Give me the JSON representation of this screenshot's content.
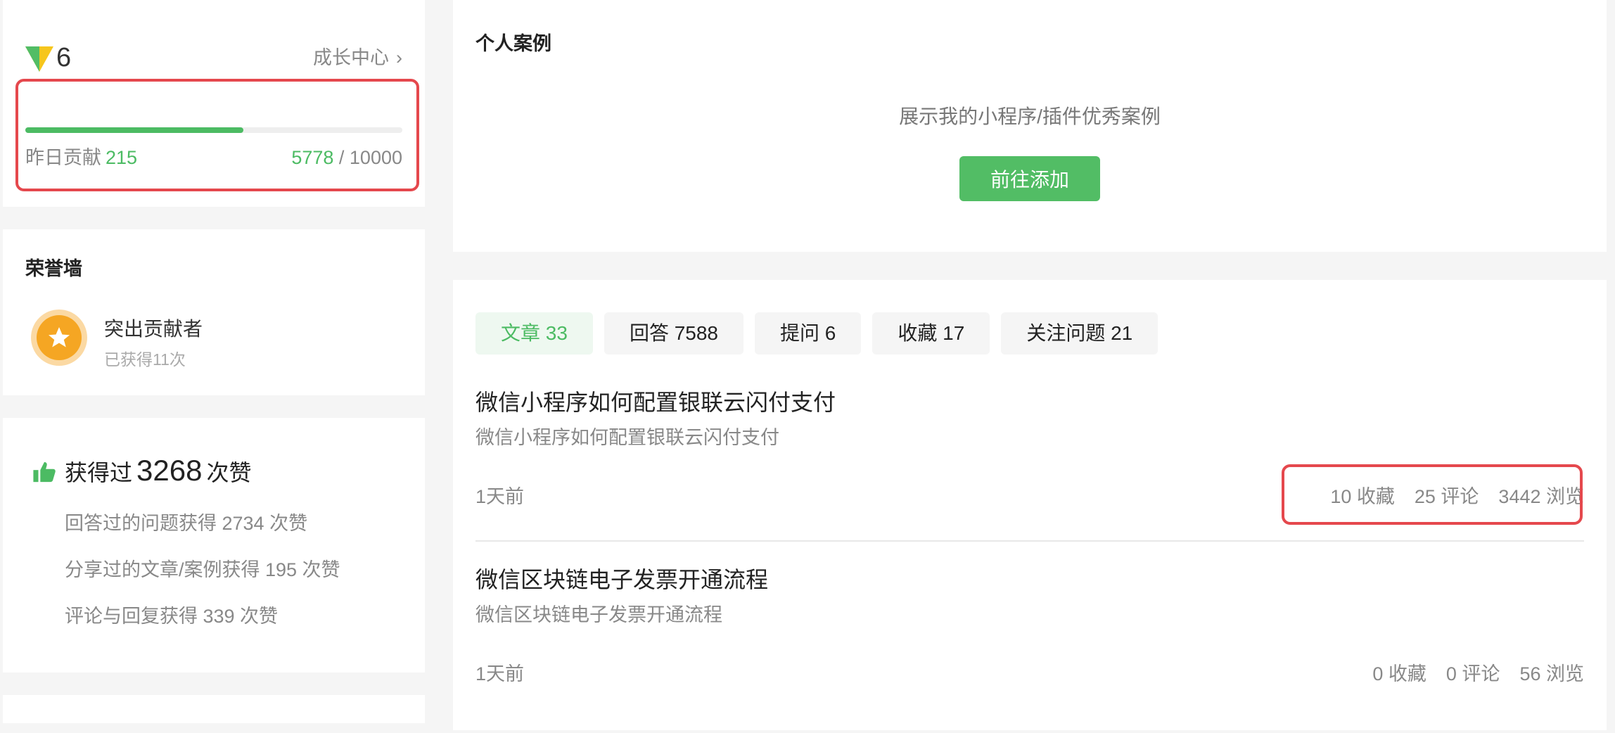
{
  "level": {
    "value": "6",
    "growth_link": "成长中心",
    "progress_fraction": 0.5778,
    "yesterday_label": "昨日贡献",
    "yesterday_value": "215",
    "current": "5778",
    "total": " / 10000"
  },
  "honor": {
    "title": "荣誉墙",
    "badge_name": "突出贡献者",
    "badge_count": "已获得11次"
  },
  "likes": {
    "prefix": "获得过",
    "total": "3268",
    "suffix": "次赞",
    "lines": [
      "回答过的问题获得 2734 次赞",
      "分享过的文章/案例获得 195 次赞",
      "评论与回复获得 339 次赞"
    ]
  },
  "case": {
    "title": "个人案例",
    "description": "展示我的小程序/插件优秀案例",
    "add_button": "前往添加"
  },
  "tabs": [
    {
      "label": "文章 33",
      "active": true
    },
    {
      "label": "回答 7588",
      "active": false
    },
    {
      "label": "提问 6",
      "active": false
    },
    {
      "label": "收藏 17",
      "active": false
    },
    {
      "label": "关注问题 21",
      "active": false
    }
  ],
  "articles": [
    {
      "title": "微信小程序如何配置银联云闪付支付",
      "desc": "微信小程序如何配置银联云闪付支付",
      "time": "1天前",
      "favorites": "10 收藏",
      "comments": "25 评论",
      "views": "3442 浏览"
    },
    {
      "title": "微信区块链电子发票开通流程",
      "desc": "微信区块链电子发票开通流程",
      "time": "1天前",
      "favorites": "0 收藏",
      "comments": "0 评论",
      "views": "56 浏览"
    }
  ],
  "colors": {
    "accent": "#4cbb63",
    "highlight": "#e5484d",
    "medal": "#f5a623"
  }
}
